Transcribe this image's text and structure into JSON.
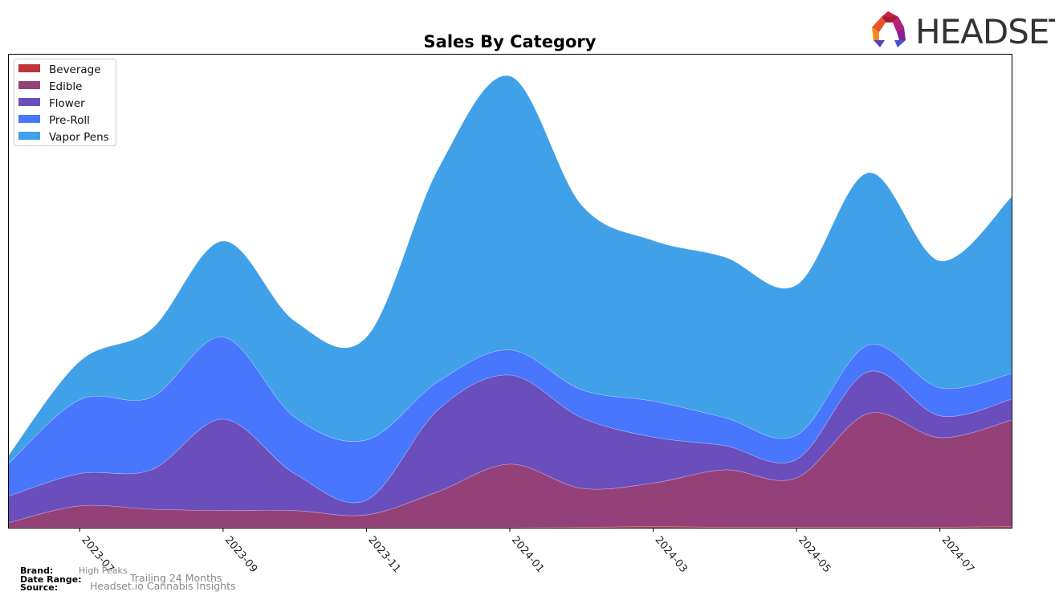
{
  "chart_data": {
    "type": "area",
    "stacked": true,
    "smoothed": true,
    "title": "Sales By Category",
    "xlabel": "",
    "ylabel": "",
    "y_axis_visible": false,
    "ylim": [
      0,
      100
    ],
    "y_units": "relative sales (unlabeled axis)",
    "x": [
      "2023-06",
      "2023-07",
      "2023-08",
      "2023-09",
      "2023-10",
      "2023-11",
      "2023-12",
      "2024-01",
      "2024-02",
      "2024-03",
      "2024-04",
      "2024-05",
      "2024-06",
      "2024-07",
      "2024-08"
    ],
    "x_tick_labels": [
      "2023-07",
      "2023-09",
      "2023-11",
      "2024-01",
      "2024-03",
      "2024-05",
      "2024-07"
    ],
    "grid": false,
    "legend_position": "top-left",
    "series": [
      {
        "name": "Beverage",
        "color": "#c0343c",
        "values": [
          0,
          0,
          0,
          0,
          0,
          0,
          0,
          0,
          0.1,
          0.2,
          0.1,
          0.1,
          0.1,
          0.1,
          0.2
        ]
      },
      {
        "name": "Edible",
        "color": "#954179",
        "values": [
          1.0,
          4.6,
          3.9,
          3.6,
          3.6,
          2.7,
          7.6,
          13.4,
          8.2,
          9.2,
          12.1,
          10.4,
          24.0,
          18.9,
          22.5
        ]
      },
      {
        "name": "Flower",
        "color": "#6a4fbc",
        "values": [
          5.6,
          6.8,
          8.3,
          19.3,
          7.8,
          3.1,
          17.3,
          18.8,
          14.9,
          9.7,
          5.1,
          3.9,
          8.8,
          4.6,
          4.4
        ]
      },
      {
        "name": "Pre-Roll",
        "color": "#4876fd",
        "values": [
          6.8,
          15.6,
          15.3,
          17.3,
          11.9,
          12.7,
          5.9,
          5.3,
          5.9,
          7.6,
          5.9,
          5.1,
          5.6,
          5.9,
          5.4
        ]
      },
      {
        "name": "Vapor Pens",
        "color": "#40a0e8",
        "values": [
          1.7,
          8.1,
          14.4,
          20.3,
          20.3,
          21.7,
          44.9,
          57.8,
          39.0,
          33.9,
          33.9,
          31.7,
          36.4,
          26.8,
          37.3
        ]
      }
    ]
  },
  "logo": {
    "text": "HEADSET"
  },
  "footer": {
    "brand_label": "Brand:",
    "brand_value": "High Peaks",
    "date_range_label": "Date Range:",
    "date_range_value": "Trailing 24 Months",
    "source_label": "Source:",
    "source_value": "Headset.io Cannabis Insights"
  }
}
